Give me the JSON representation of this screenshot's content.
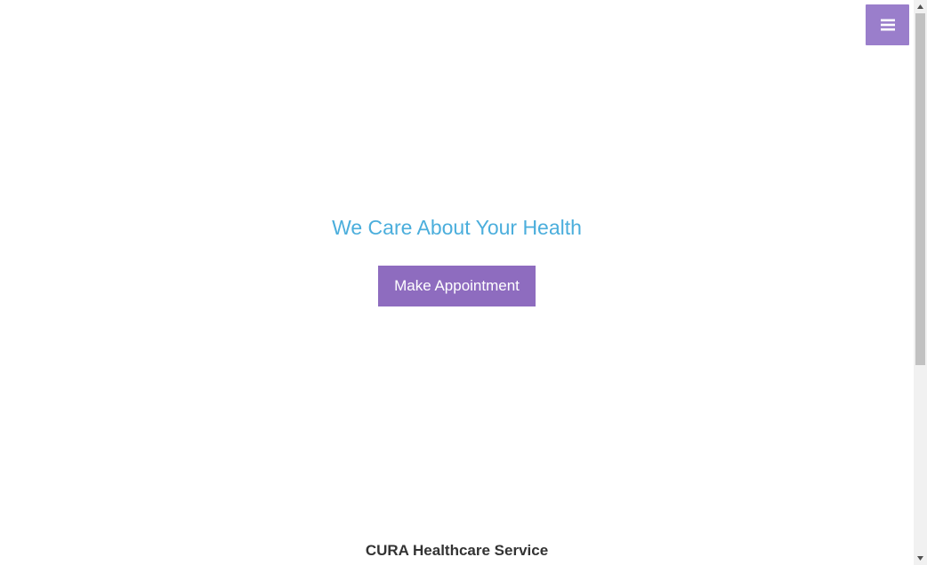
{
  "header": {
    "menu_toggle_icon": "hamburger-menu-icon",
    "accent_color": "#9a7ecb"
  },
  "hero": {
    "title": "We Care About Your Health",
    "title_color": "#4baedc",
    "cta_label": "Make Appointment",
    "cta_color": "#8e6cbf"
  },
  "footer": {
    "brand": "CURA Healthcare Service"
  },
  "scrollbar": {
    "up_icon": "scroll-up-arrow-icon",
    "down_icon": "scroll-down-arrow-icon"
  }
}
